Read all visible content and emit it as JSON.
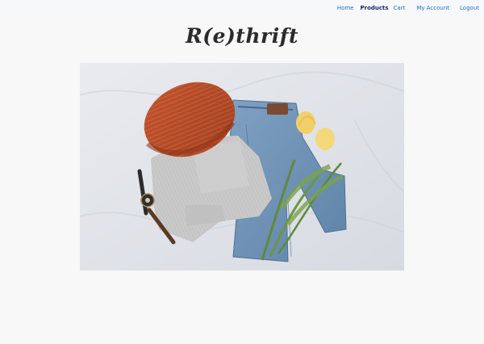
{
  "nav": {
    "items": [
      {
        "label": "Home"
      },
      {
        "label": "Products",
        "active": true
      },
      {
        "label": "Cart"
      },
      {
        "label": "My Account"
      },
      {
        "label": "Logout"
      }
    ],
    "link_color": "#1f6fd6",
    "active_color": "#1a2a6a"
  },
  "brand": {
    "title": "R(e)thrift"
  },
  "hero": {
    "image_subject": "flat-lay of knit beanie, grey sweater, jeans, wristwatch and yellow tulips on white bedsheet"
  }
}
